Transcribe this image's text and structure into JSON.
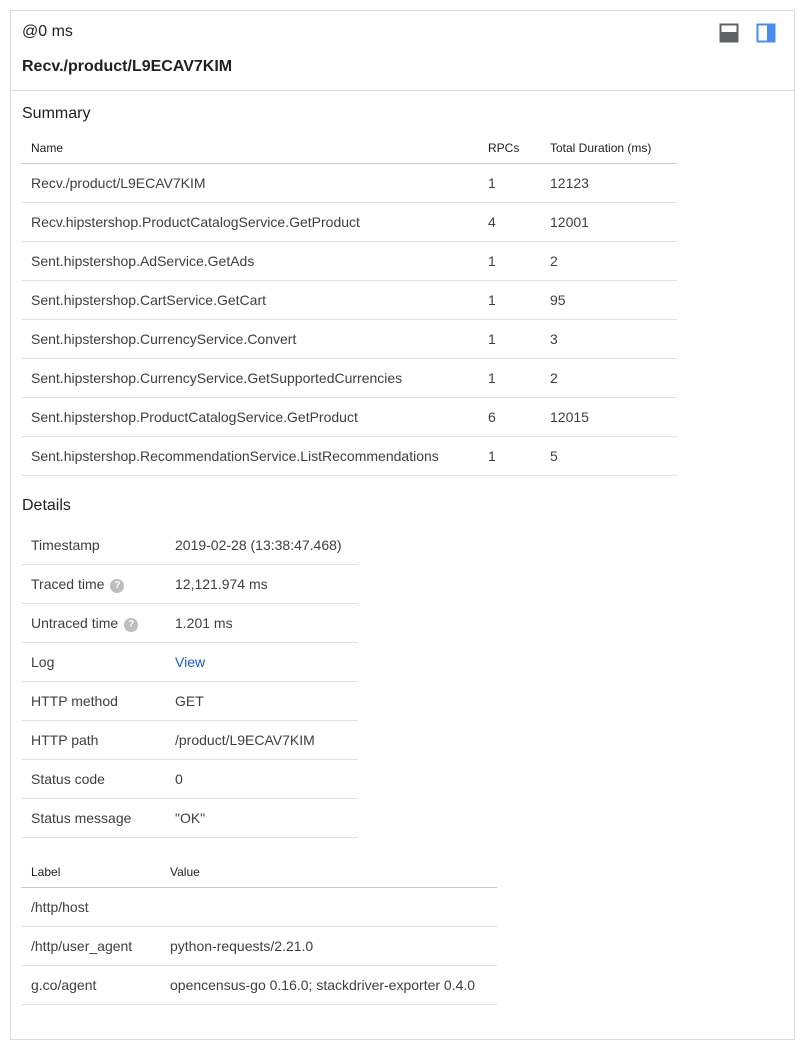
{
  "header": {
    "offset": "@0 ms",
    "span_name": "Recv./product/L9ECAV7KIM",
    "icons": [
      "split-horizontal-icon",
      "split-vertical-icon"
    ],
    "accent_color": "#4a8df0"
  },
  "summary": {
    "title": "Summary",
    "columns": [
      "Name",
      "RPCs",
      "Total Duration (ms)"
    ],
    "rows": [
      [
        "Recv./product/L9ECAV7KIM",
        "1",
        "12123"
      ],
      [
        "Recv.hipstershop.ProductCatalogService.GetProduct",
        "4",
        "12001"
      ],
      [
        "Sent.hipstershop.AdService.GetAds",
        "1",
        "2"
      ],
      [
        "Sent.hipstershop.CartService.GetCart",
        "1",
        "95"
      ],
      [
        "Sent.hipstershop.CurrencyService.Convert",
        "1",
        "3"
      ],
      [
        "Sent.hipstershop.CurrencyService.GetSupportedCurrencies",
        "1",
        "2"
      ],
      [
        "Sent.hipstershop.ProductCatalogService.GetProduct",
        "6",
        "12015"
      ],
      [
        "Sent.hipstershop.RecommendationService.ListRecommendations",
        "1",
        "5"
      ]
    ]
  },
  "details": {
    "title": "Details",
    "rows": [
      {
        "key": "Timestamp",
        "value": "2019-02-28 (13:38:47.468)"
      },
      {
        "key": "Traced time",
        "value": "12,121.974 ms",
        "help": "?"
      },
      {
        "key": "Untraced time",
        "value": "1.201 ms",
        "help": "?"
      },
      {
        "key": "Log",
        "value": "View"
      },
      {
        "key": "HTTP method",
        "value": "GET"
      },
      {
        "key": "HTTP path",
        "value": "/product/L9ECAV7KIM"
      },
      {
        "key": "Status code",
        "value": "0"
      },
      {
        "key": "Status message",
        "value": "\"OK\""
      }
    ]
  },
  "labels": {
    "columns": [
      "Label",
      "Value"
    ],
    "rows": [
      [
        "/http/host",
        ""
      ],
      [
        "/http/user_agent",
        "python-requests/2.21.0"
      ],
      [
        "g.co/agent",
        "opencensus-go 0.16.0; stackdriver-exporter 0.4.0"
      ]
    ]
  }
}
